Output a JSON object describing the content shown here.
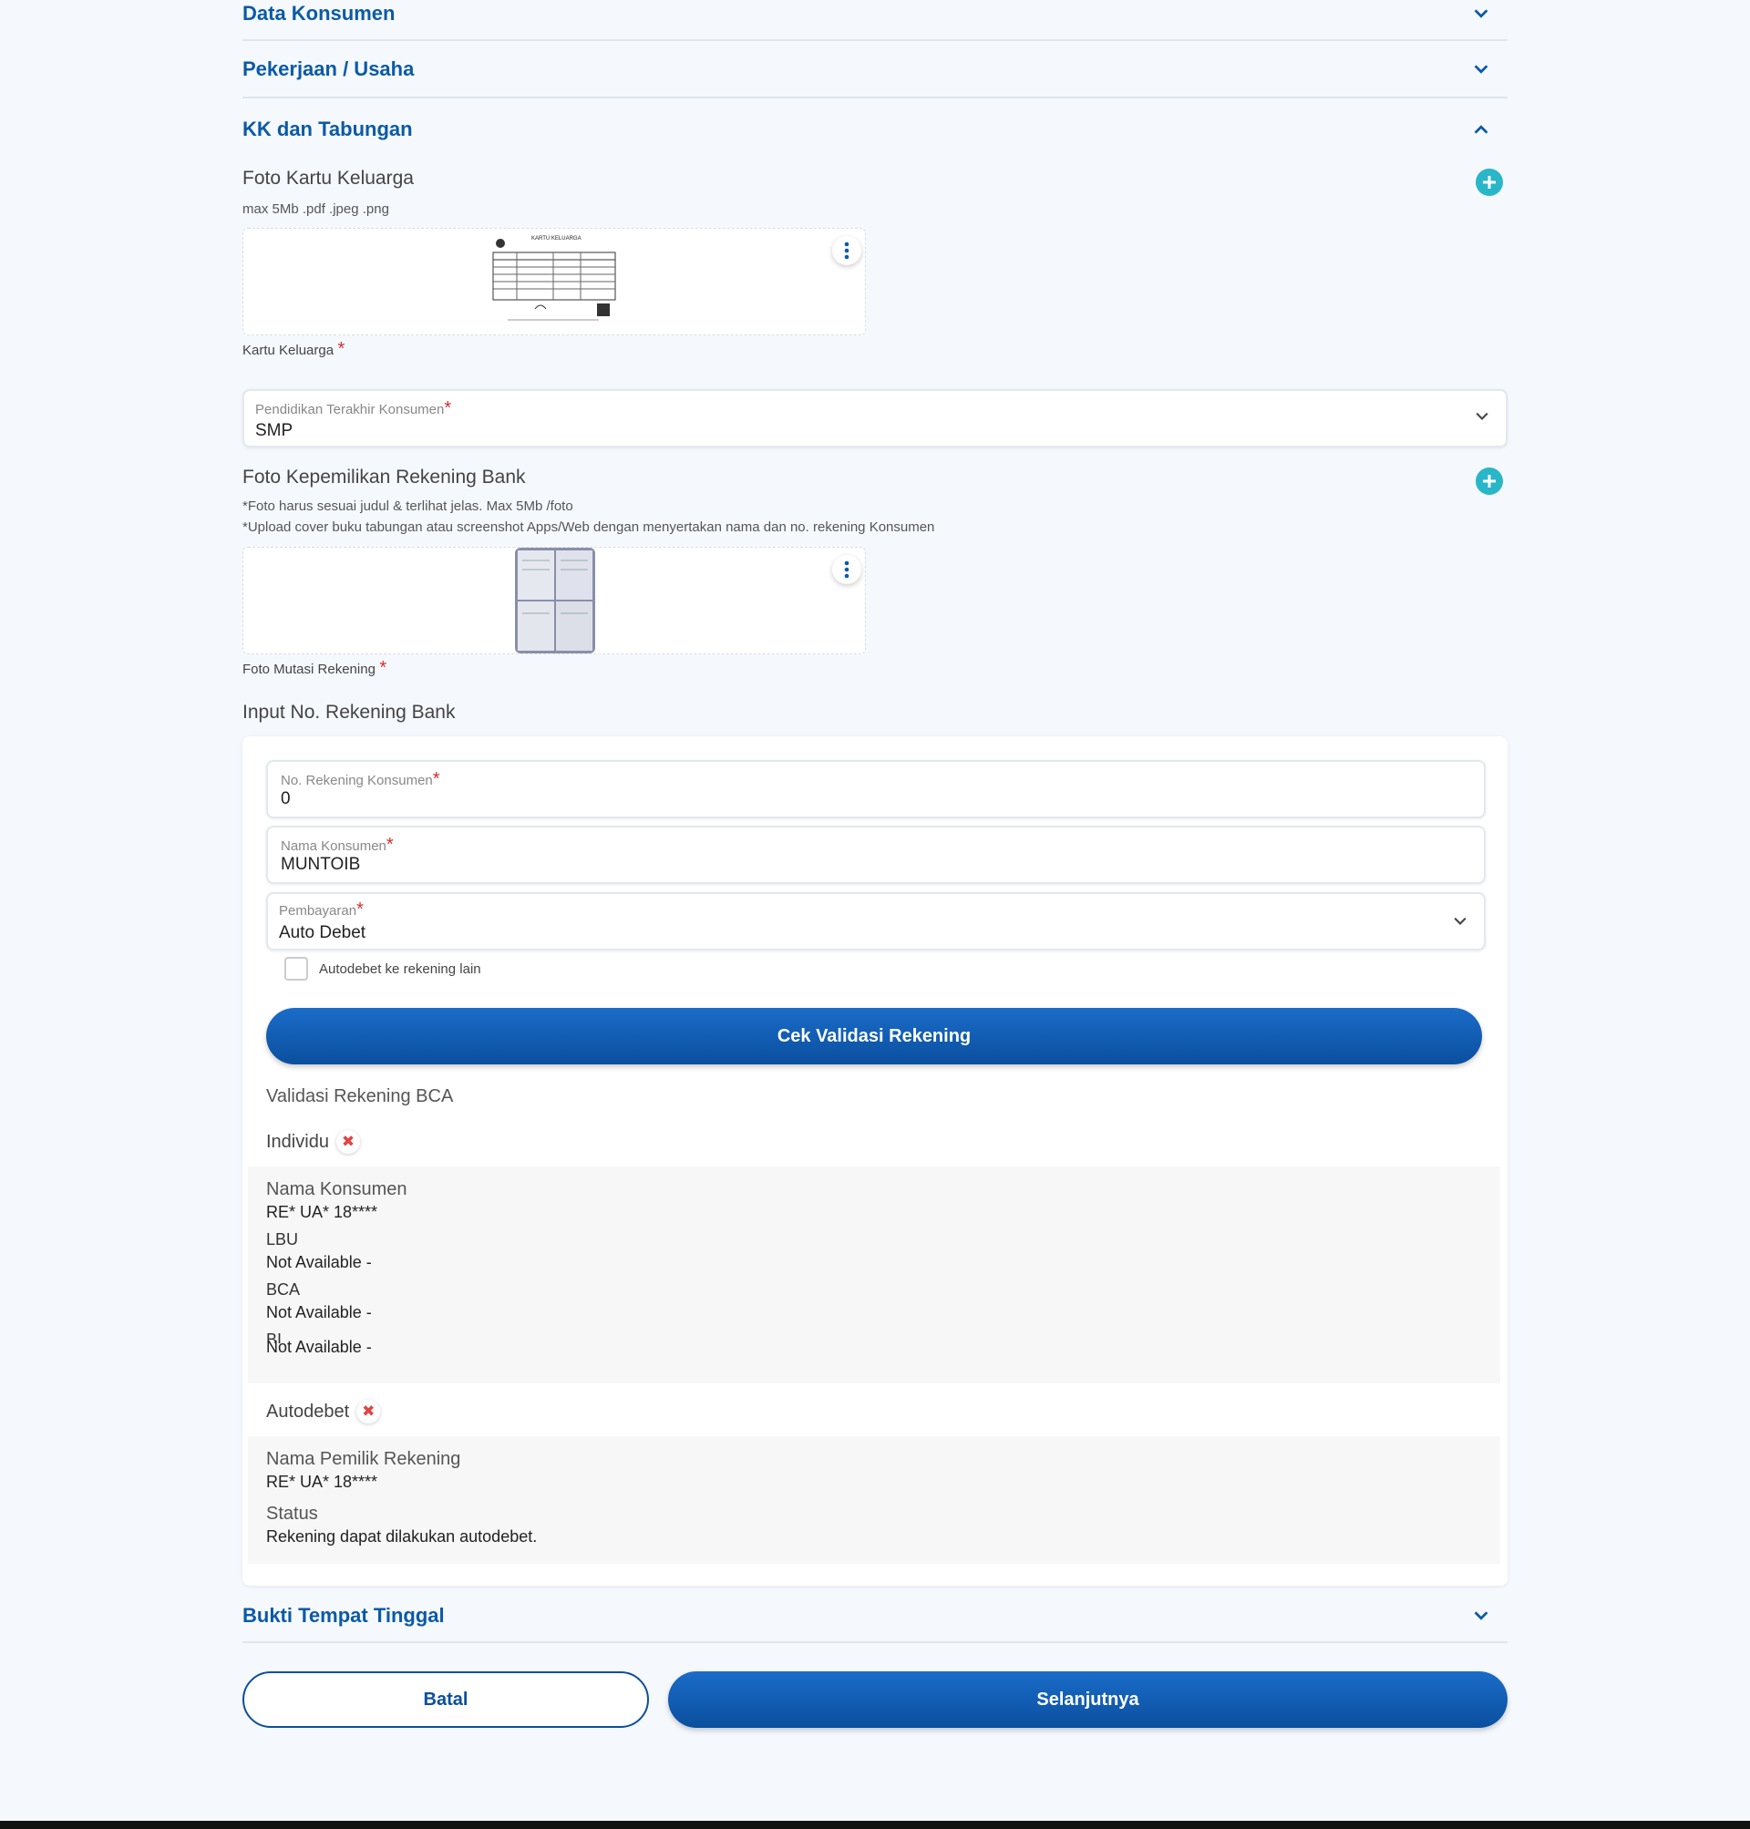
{
  "accordions": {
    "data_konsumen": "Data Konsumen",
    "pekerjaan": "Pekerjaan / Usaha",
    "kk_tabungan": "KK dan Tabungan",
    "bukti_tempat": "Bukti Tempat Tinggal"
  },
  "kk": {
    "title": "Foto Kartu Keluarga",
    "hint": "max 5Mb .pdf .jpeg .png",
    "file_label": "Kartu Keluarga",
    "thumb_title": "KARTU KELUARGA"
  },
  "pendidikan": {
    "label": "Pendidikan Terakhir Konsumen",
    "value": "SMP"
  },
  "rekening_foto": {
    "title": "Foto Kepemilikan Rekening Bank",
    "hint1": "*Foto harus sesuai judul & terlihat jelas. Max 5Mb /foto",
    "hint2": "*Upload cover buku tabungan atau screenshot Apps/Web dengan menyertakan nama dan no. rekening Konsumen",
    "file_label": "Foto Mutasi Rekening"
  },
  "input_rek": {
    "title": "Input No. Rekening Bank",
    "no_rek_label": "No. Rekening Konsumen",
    "no_rek_value": "0",
    "nama_label": "Nama Konsumen",
    "nama_value": "MUNTOIB",
    "pembayaran_label": "Pembayaran",
    "pembayaran_value": "Auto Debet",
    "checkbox_label": "Autodebet ke rekening lain",
    "cek_button": "Cek Validasi Rekening"
  },
  "validasi": {
    "title": "Validasi Rekening BCA",
    "individu": "Individu",
    "nama_k": "Nama Konsumen",
    "nama_v": "RE* UA* 18****",
    "lbu_k": "LBU",
    "lbu_v": "Not Available -",
    "bca_k": "BCA",
    "bca_v": "Not Available -",
    "bi_k": "BI",
    "bi_v": "Not Available -",
    "autodebet": "Autodebet",
    "pemilik_k": "Nama Pemilik Rekening",
    "pemilik_v": "RE* UA* 18****",
    "status_k": "Status",
    "status_v": "Rekening dapat dilakukan autodebet."
  },
  "actions": {
    "batal": "Batal",
    "selanjutnya": "Selanjutnya"
  },
  "required_mark": "*",
  "colors": {
    "accent": "#0b5aa6",
    "plus": "#29b6c8",
    "required": "#d32f2f",
    "error": "#e04545"
  }
}
